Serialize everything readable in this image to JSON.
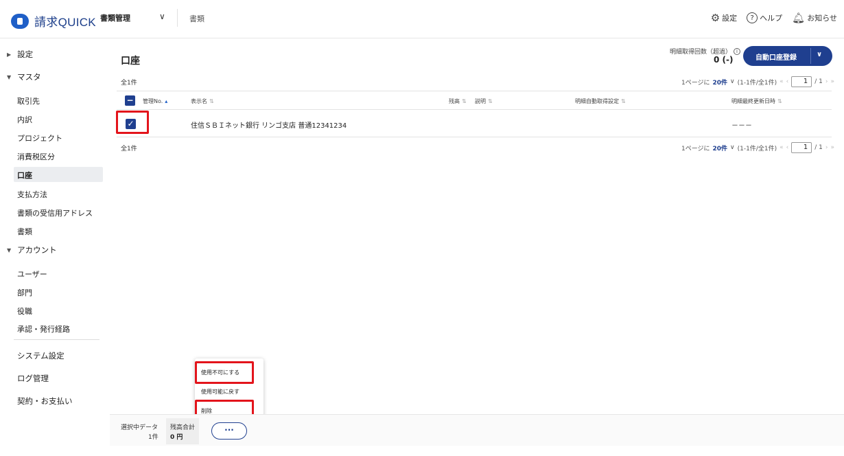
{
  "header": {
    "logo_text": "請求QUICK",
    "app_switch": "書類管理",
    "chevron": "∨",
    "sub_title": "書類",
    "settings": "設定",
    "help": "ヘルプ",
    "notifications": "お知らせ",
    "icons": {
      "settings": "gear-icon",
      "help": "help-circle-icon",
      "notifications": "bell-icon"
    }
  },
  "sidebar": {
    "settings_group": "設定",
    "master_group": "マスタ",
    "master_items": [
      "取引先",
      "内訳",
      "プロジェクト",
      "消費税区分",
      "口座",
      "支払方法",
      "書類の受信用アドレス",
      "書類"
    ],
    "active_item": "口座",
    "account_group": "アカウント",
    "account_items": [
      "ユーザー",
      "部門",
      "役職",
      "承認・発行経路"
    ],
    "bottom_items": [
      "システム設定",
      "ログ管理",
      "契約・お支払い"
    ]
  },
  "main": {
    "title": "口座",
    "fetch_label": "明細取得回数（超過）",
    "fetch_value": "0 (-)",
    "auto_button": "自動口座登録",
    "count_text": "全1件",
    "pager": {
      "per_page_prefix": "1ページに",
      "per_page": "20件",
      "range": "(1-1件/全1件)",
      "page": "1",
      "total_pages": "/ 1"
    },
    "table": {
      "headers": [
        "管理No.",
        "表示名",
        "残高",
        "説明",
        "明細自動取得設定",
        "明細最終更新日時"
      ],
      "rows": [
        {
          "name": "住信ＳＢＩネット銀行 リンゴ支店 普通12341234",
          "last_updated": "－－－"
        }
      ]
    }
  },
  "popup_menu": {
    "items": [
      "使用不可にする",
      "使用可能に戻す",
      "削除"
    ]
  },
  "bottom_bar": {
    "selected_label": "選択中データ",
    "selected_count": "1件",
    "balance_label": "残高合計",
    "balance_value": "0 円",
    "more_button": "···"
  },
  "colors": {
    "accent": "#1f3f8f",
    "highlight": "#e3141b"
  }
}
